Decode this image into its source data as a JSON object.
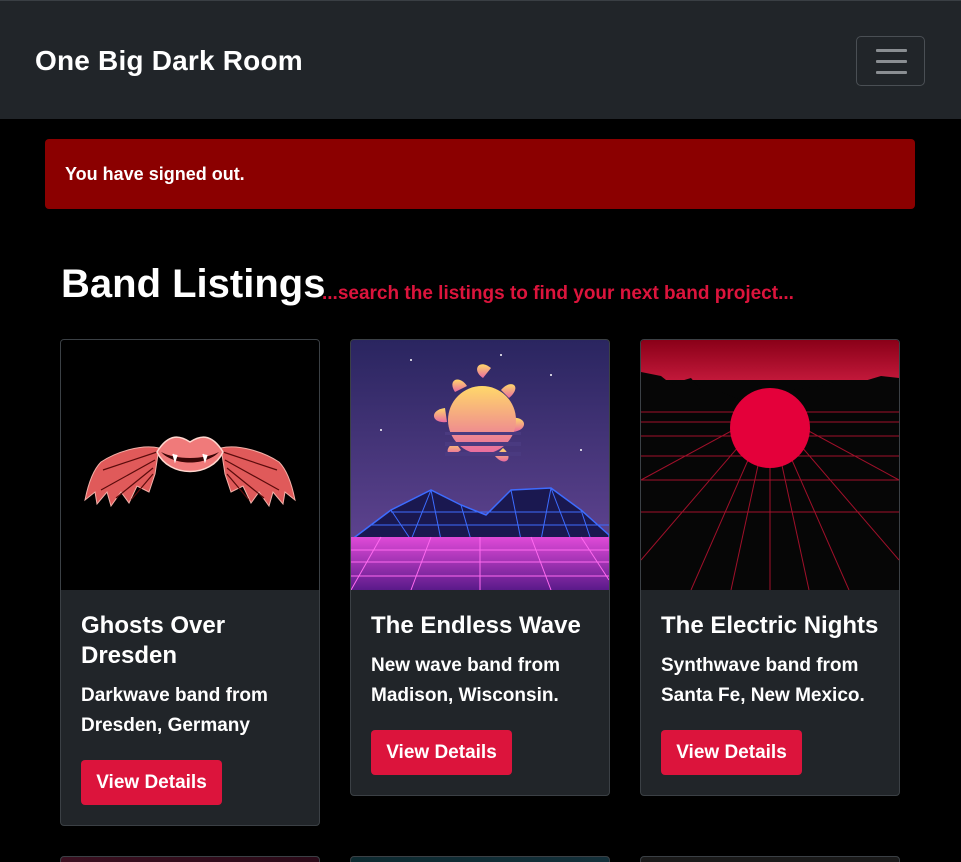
{
  "navbar": {
    "brand": "One Big Dark Room",
    "toggle_icon": "hamburger-icon"
  },
  "alert": {
    "message": "You have signed out."
  },
  "header": {
    "title": "Band Listings",
    "subtitle": "...search the listings to find your next band project..."
  },
  "colors": {
    "accent": "#dc143c",
    "alert_bg": "#8b0000",
    "navbar_bg": "#212529",
    "card_bg": "#212529",
    "page_bg": "#000000"
  },
  "cards": [
    {
      "title": "Ghosts Over Dresden",
      "description": "Darkwave band from Dresden, Germany",
      "button": "View Details",
      "image": "bat-wing-lips-image"
    },
    {
      "title": "The Endless Wave",
      "description": "New wave band from Madison, Wisconsin.",
      "button": "View Details",
      "image": "retro-sun-mountains-image"
    },
    {
      "title": "The Electric Nights",
      "description": "Synthwave band from Santa Fe, New Mexico.",
      "button": "View Details",
      "image": "red-sun-grid-image"
    }
  ]
}
